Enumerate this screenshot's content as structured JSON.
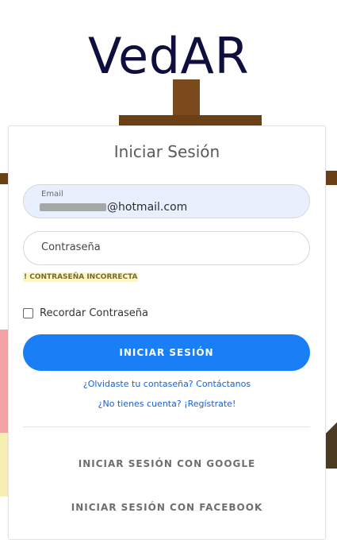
{
  "brand": {
    "title": "VedAR"
  },
  "login": {
    "title": "Iniciar Sesión",
    "email": {
      "label": "Email",
      "value_visible_suffix": "@hotmail.com"
    },
    "password": {
      "placeholder": "Contraseña"
    },
    "error": "! CONTRASEÑA INCORRECTA",
    "remember_label": "Recordar Contraseña",
    "submit_label": "INICIAR SESIÓN",
    "forgot_link": "¿Olvidaste tu contaseña? Contáctanos",
    "register_link": "¿No tienes cuenta? ¡Regístrate!",
    "google_label": "INICIAR SESIÓN CON GOOGLE",
    "facebook_label": "INICIAR SESIÓN CON FACEBOOK"
  },
  "colors": {
    "primary": "#1a7ff5",
    "brand_text": "#0f0f3d",
    "error_text": "#7a6a2a",
    "error_bg": "#fbf6c8",
    "link": "#1a5fd0",
    "email_field_bg": "#e8f0fe"
  }
}
